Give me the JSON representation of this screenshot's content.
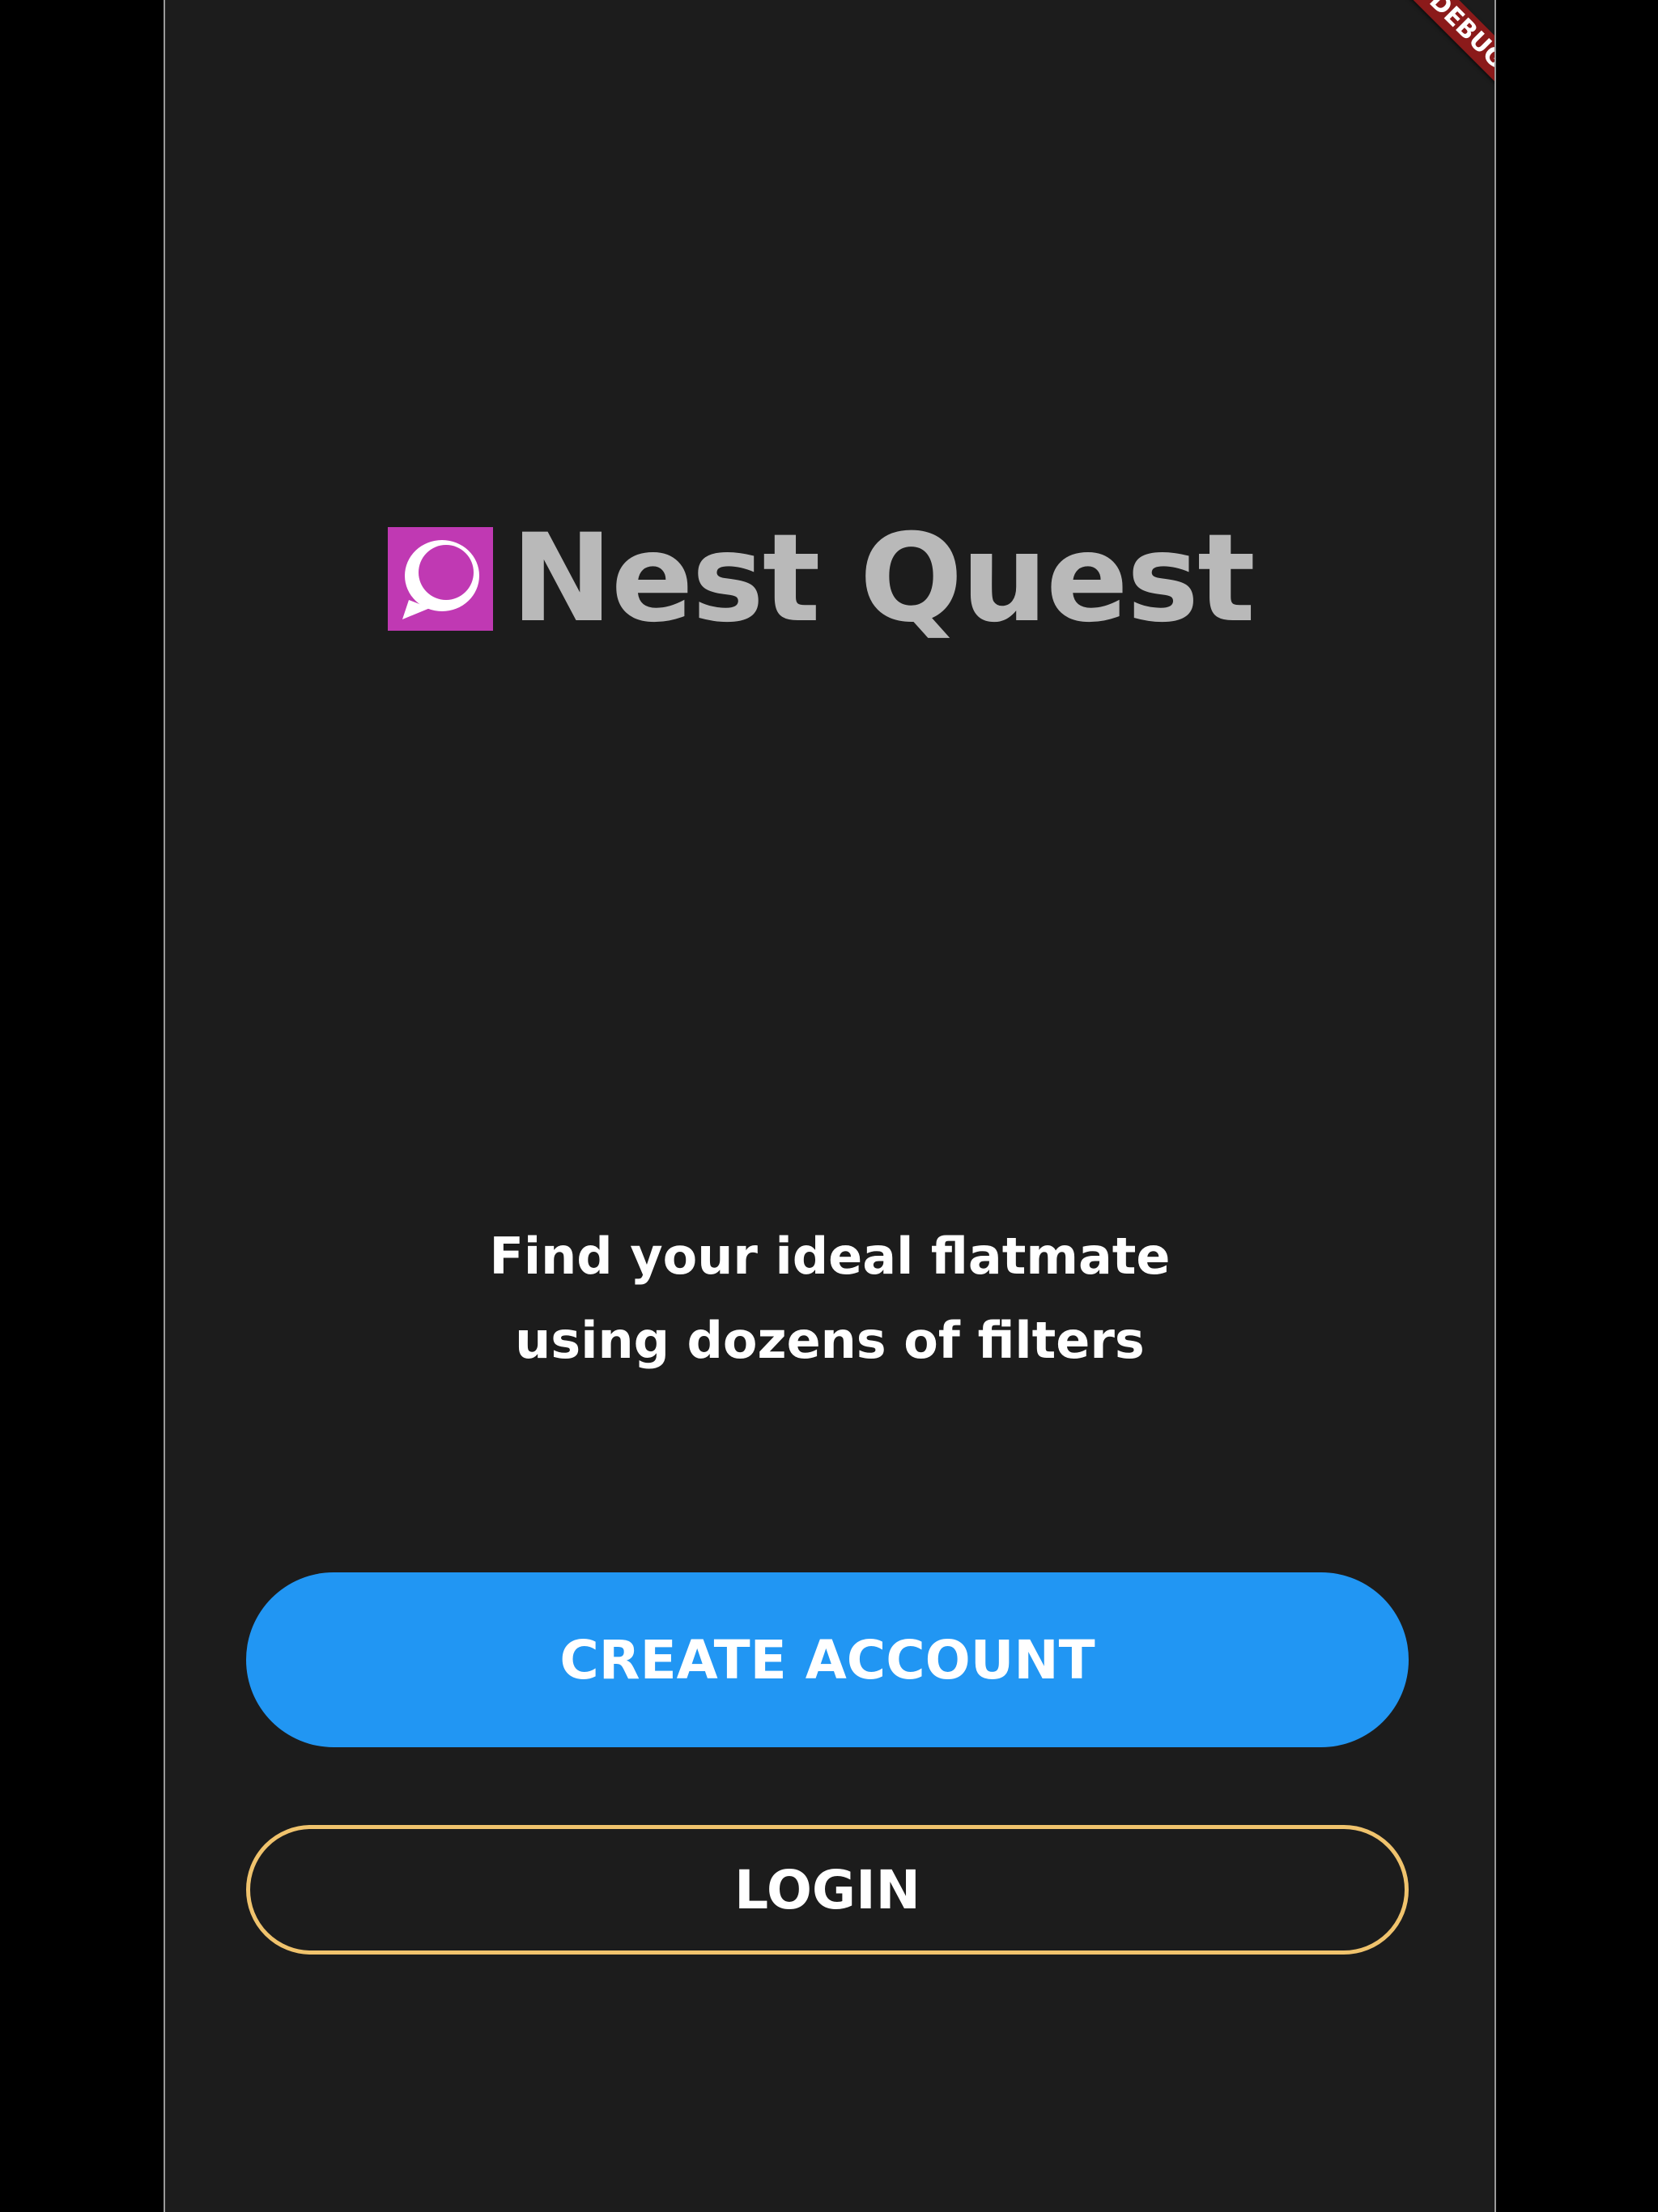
{
  "app": {
    "title": "Nest Quest",
    "logo_icon": "speech-bubble-icon",
    "logo_color": "#c039b3"
  },
  "debug_banner": {
    "label": "DEBUG"
  },
  "tagline": {
    "line1": "Find your ideal flatmate",
    "line2": "using dozens of filters"
  },
  "buttons": {
    "create_account": "CREATE ACCOUNT",
    "login": "LOGIN"
  },
  "colors": {
    "background": "#1c1c1c",
    "primary_button": "#2196f3",
    "login_border": "#f0c36d",
    "title_text": "#b9b9b9"
  }
}
